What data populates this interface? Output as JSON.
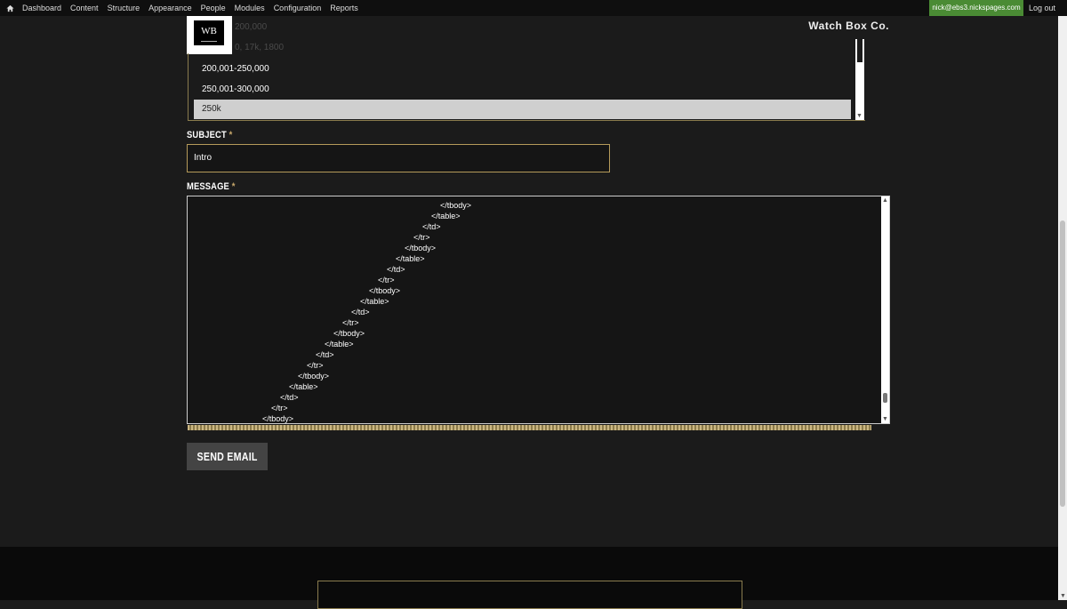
{
  "toolbar": {
    "home_icon": "home-icon",
    "items": [
      "Dashboard",
      "Content",
      "Structure",
      "Appearance",
      "People",
      "Modules",
      "Configuration",
      "Reports"
    ],
    "user": "nick@ebs3.nickspages.com",
    "logout": "Log out",
    "user_color": "#4a8b34"
  },
  "brand": {
    "logo_text": "WB",
    "name": "Watch Box Co.",
    "faded_1": "200,000",
    "faded_2": "0, 17k, 1800"
  },
  "listbox": {
    "options": [
      "200,001-250,000",
      "250,001-300,000",
      "250k"
    ],
    "selected": "250k"
  },
  "form": {
    "subject_label": "SUBJECT",
    "subject_value": "Intro",
    "message_label": "MESSAGE",
    "required_mark": "*",
    "accent_color": "#c7a76a",
    "message_lines": [
      "</tbody>",
      "</table>",
      "</td>",
      "</tr>",
      "</tbody>",
      "</table>",
      "</td>",
      "</tr>",
      "</tbody>",
      "</table>",
      "</td>",
      "</tr>",
      "</tbody>",
      "</table>",
      "</td>",
      "</tr>",
      "</tbody>",
      "</table>",
      "</td>",
      "</tr>",
      "</tbody>"
    ],
    "send_label": "SEND EMAIL"
  }
}
